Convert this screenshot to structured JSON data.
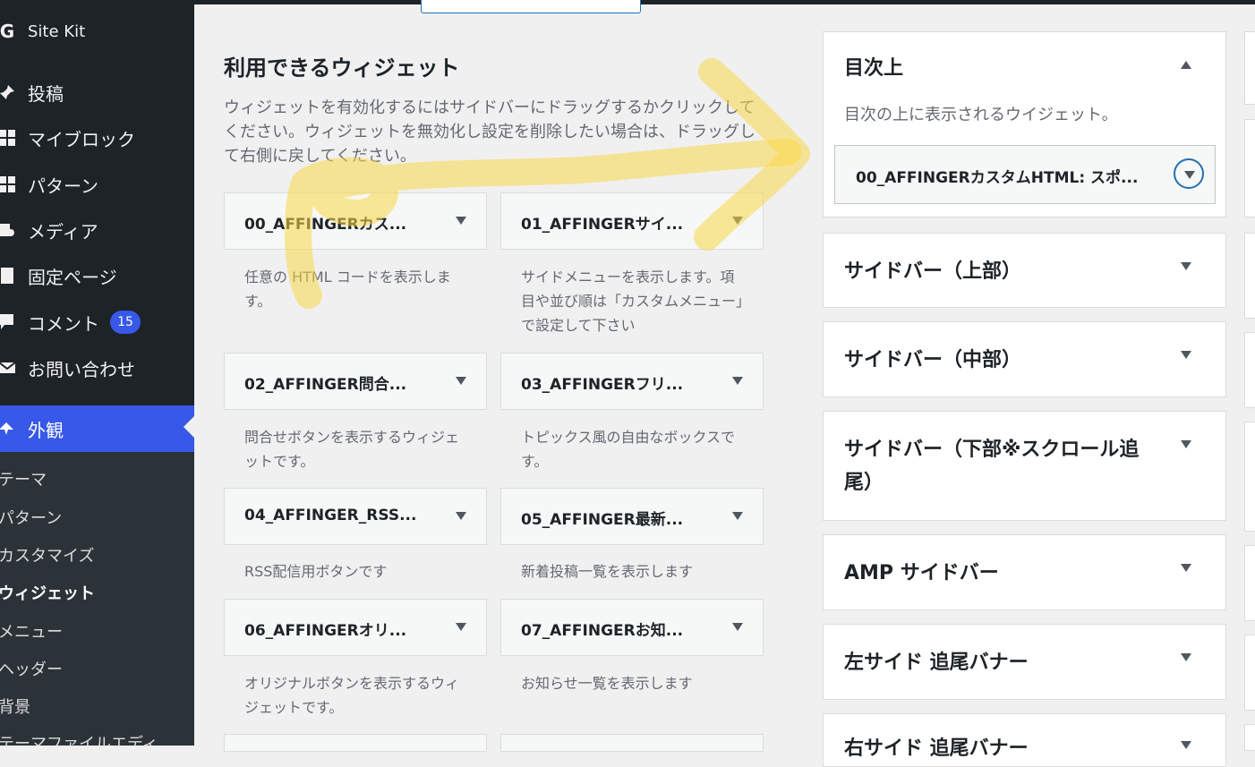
{
  "sidebar": {
    "site_kit": "Site Kit",
    "items": [
      {
        "label": "投稿",
        "icon": "pin-icon"
      },
      {
        "label": "マイブロック",
        "icon": "grid-icon"
      },
      {
        "label": "パターン",
        "icon": "grid-icon"
      },
      {
        "label": "メディア",
        "icon": "media-icon"
      },
      {
        "label": "固定ページ",
        "icon": "page-icon"
      },
      {
        "label": "コメント",
        "icon": "comment-icon",
        "badge": "15"
      },
      {
        "label": "お問い合わせ",
        "icon": "mail-icon"
      },
      {
        "label": "外観",
        "icon": "brush-icon",
        "active": true
      }
    ],
    "submenu": [
      "テーマ",
      "パターン",
      "カスタマイズ",
      "ウィジェット",
      "メニュー",
      "ヘッダー",
      "背景",
      "テーマファイルエディ"
    ],
    "current_submenu": "ウィジェット"
  },
  "available": {
    "title": "利用できるウィジェット",
    "description": "ウィジェットを有効化するにはサイドバーにドラッグするかクリックしてください。ウィジェットを無効化し設定を削除したい場合は、ドラッグして右側に戻してください。",
    "widgets": [
      {
        "title": "00_AFFINGERカス...",
        "desc": "任意の HTML コードを表示します。"
      },
      {
        "title": "01_AFFINGERサイ...",
        "desc": "サイドメニューを表示します。項目や並び順は「カスタムメニュー」で設定して下さい"
      },
      {
        "title": "02_AFFINGER問合...",
        "desc": "問合せボタンを表示するウィジェットです。"
      },
      {
        "title": "03_AFFINGERフリ...",
        "desc": "トピックス風の自由なボックスです。"
      },
      {
        "title": "04_AFFINGER_RSS...",
        "desc": "RSS配信用ボタンです"
      },
      {
        "title": "05_AFFINGER最新...",
        "desc": "新着投稿一覧を表示します"
      },
      {
        "title": "06_AFFINGERオリ...",
        "desc": "オリジナルボタンを表示するウィジェットです。"
      },
      {
        "title": "07_AFFINGERお知...",
        "desc": "お知らせ一覧を表示します"
      }
    ]
  },
  "areas": [
    {
      "title": "目次上",
      "desc": "目次の上に表示されるウイジェット。",
      "widget": "00_AFFINGERカスタムHTML: スポ...",
      "expanded": true
    },
    {
      "title": "サイドバー（上部）"
    },
    {
      "title": "サイドバー（中部）"
    },
    {
      "title": "サイドバー（下部※スクロール追尾）"
    },
    {
      "title": "AMP サイドバー"
    },
    {
      "title": "左サイド 追尾バナー"
    },
    {
      "title": "右サイド 追尾バナー"
    }
  ],
  "colors": {
    "sidebar_bg": "#1d2327",
    "active": "#3858e9",
    "highlight": "#f9d949"
  }
}
